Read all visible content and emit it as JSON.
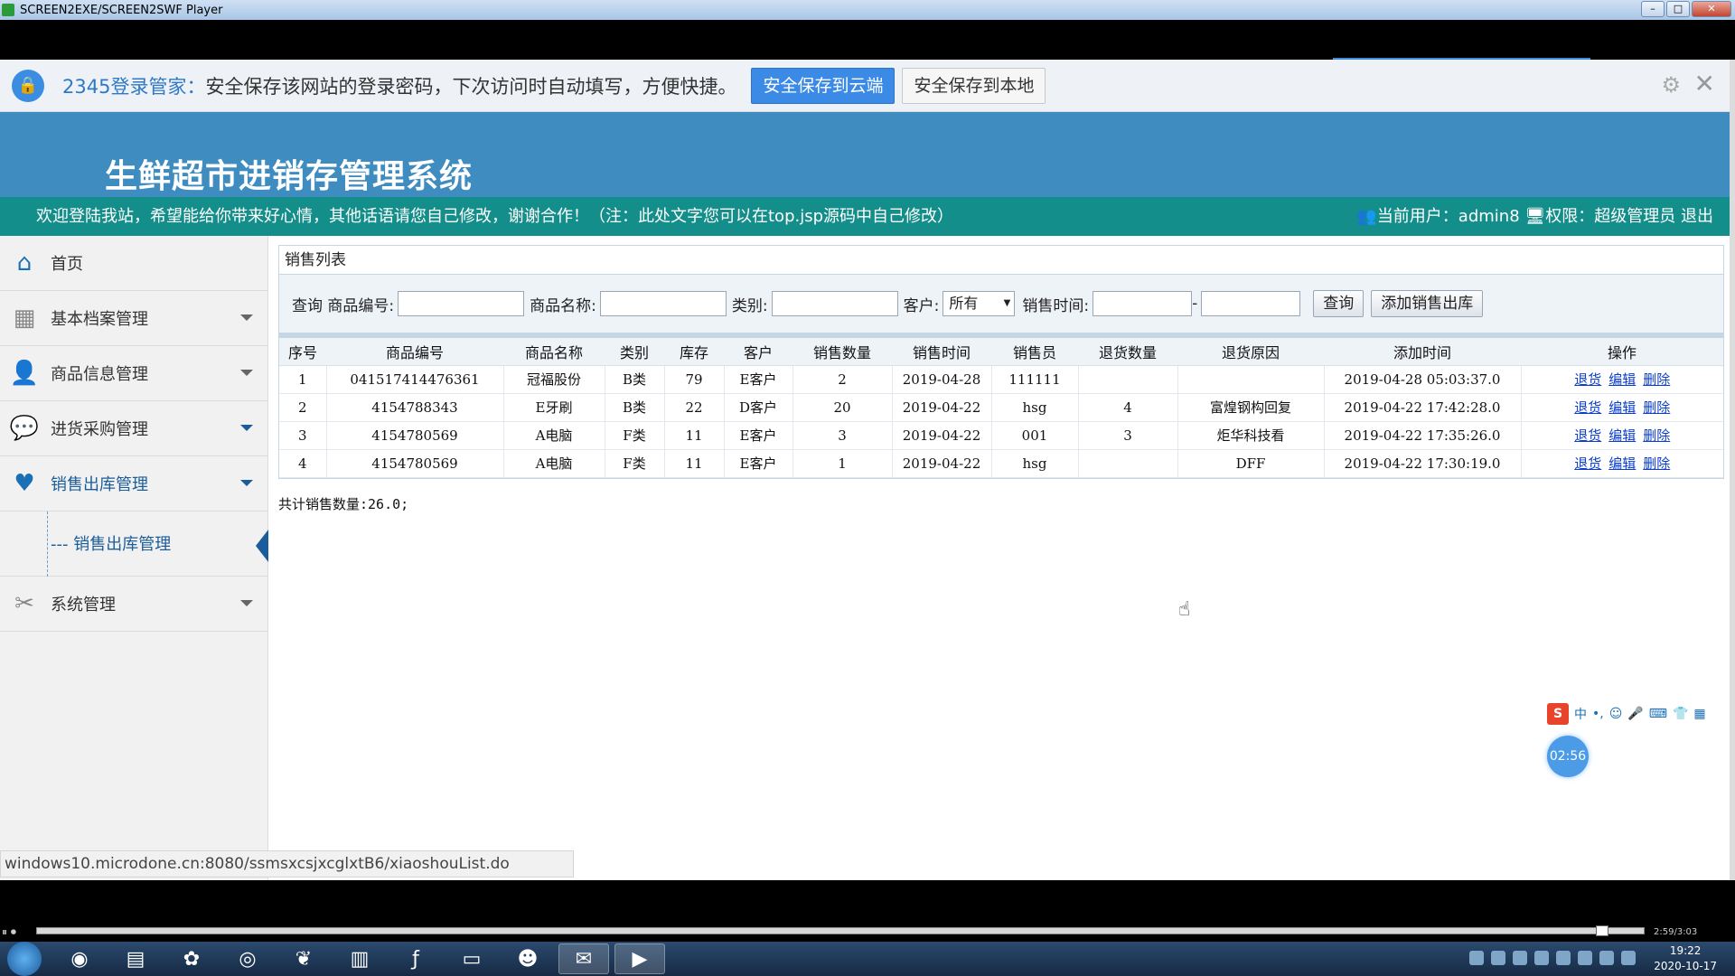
{
  "window": {
    "title": "SCREEN2EXE/SCREEN2SWF Player"
  },
  "password_bar": {
    "brand": "2345登录管家：",
    "message": "安全保存该网站的登录密码，下次访问时自动填写，方便快捷。",
    "save_cloud": "安全保存到云端",
    "save_local": "安全保存到本地"
  },
  "header": {
    "title": "生鲜超市进销存管理系统",
    "welcome": "欢迎登陆我站，希望能给你带来好心情，其他话语请您自己修改，谢谢合作！（注：此处文字您可以在top.jsp源码中自己修改）",
    "user_label": "当前用户：admin8",
    "role_label": "权限：超级管理员",
    "logout": "退出"
  },
  "sidebar": {
    "items": [
      {
        "label": "首页",
        "icon": "home-icon"
      },
      {
        "label": "基本档案管理",
        "icon": "grid-icon"
      },
      {
        "label": "商品信息管理",
        "icon": "user-icon"
      },
      {
        "label": "进货采购管理",
        "icon": "chat-icon"
      },
      {
        "label": "销售出库管理",
        "icon": "heart-icon"
      },
      {
        "label": "系统管理",
        "icon": "tools-icon"
      }
    ],
    "sub_item": "销售出库管理"
  },
  "panel": {
    "title": "销售列表",
    "search": {
      "query_label": "查询",
      "code_label": "商品编号:",
      "name_label": "商品名称:",
      "category_label": "类别:",
      "customer_label": "客户:",
      "customer_value": "所有",
      "time_label": "销售时间:",
      "query_button": "查询",
      "add_button": "添加销售出库"
    },
    "columns": [
      "序号",
      "商品编号",
      "商品名称",
      "类别",
      "库存",
      "客户",
      "销售数量",
      "销售时间",
      "销售员",
      "退货数量",
      "退货原因",
      "添加时间",
      "操作"
    ],
    "rows": [
      [
        "1",
        "041517414476361",
        "冠福股份",
        "B类",
        "79",
        "E客户",
        "2",
        "2019-04-28",
        "111111",
        "",
        "",
        "2019-04-28 05:03:37.0"
      ],
      [
        "2",
        "4154788343",
        "E牙刷",
        "B类",
        "22",
        "D客户",
        "20",
        "2019-04-22",
        "hsg",
        "4",
        "富煌钢构回复",
        "2019-04-22 17:42:28.0"
      ],
      [
        "3",
        "4154780569",
        "A电脑",
        "F类",
        "11",
        "E客户",
        "3",
        "2019-04-22",
        "001",
        "3",
        "炬华科技看",
        "2019-04-22 17:35:26.0"
      ],
      [
        "4",
        "4154780569",
        "A电脑",
        "F类",
        "11",
        "E客户",
        "1",
        "2019-04-22",
        "hsg",
        "",
        "DFF",
        "2019-04-22 17:30:19.0"
      ]
    ],
    "ops": {
      "return": "退货",
      "edit": "编辑",
      "delete": "删除"
    },
    "total": "共计销售数量:26.0;"
  },
  "status_url": "windows10.microdone.cn:8080/ssmsxcsjxcglxtB6/xiaoshouList.do",
  "timer": "02:56",
  "player": {
    "time": "2:59/3:03"
  },
  "ime": {
    "lang": "中"
  },
  "clock": {
    "time": "19:22",
    "date": "2020-10-17"
  }
}
